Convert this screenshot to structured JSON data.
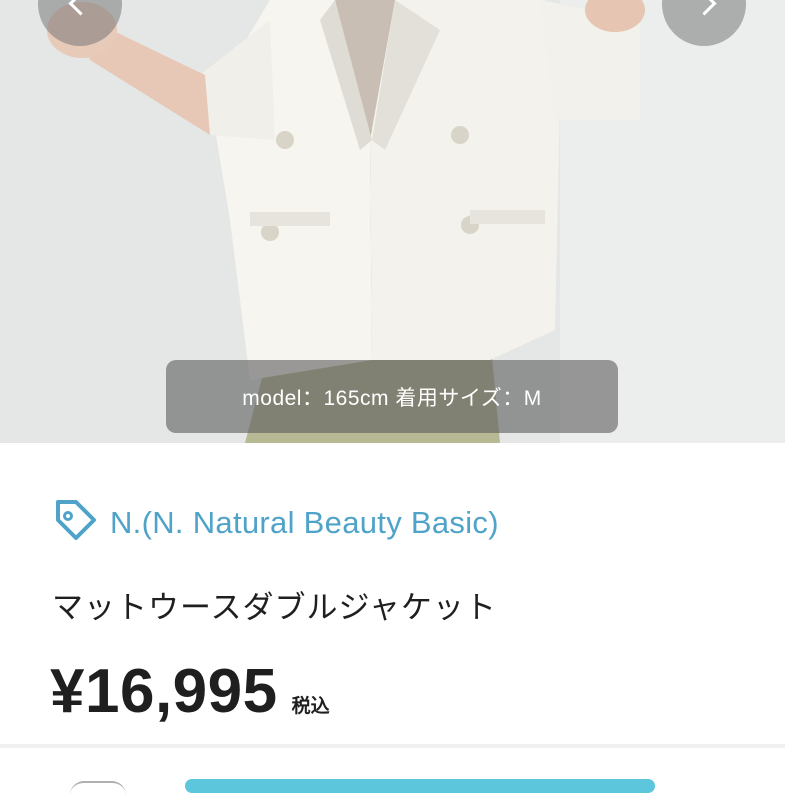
{
  "product_image": {
    "caption": "model：165cm 着用サイズ：M"
  },
  "brand": {
    "icon": "tag-icon",
    "label": "N.(N. Natural Beauty Basic)",
    "color": "#4fa3c9"
  },
  "product": {
    "title": "マットウースダブルジャケット",
    "price": "¥16,995",
    "tax_note": "税込"
  },
  "colors": {
    "cta": "#5cc6dc"
  }
}
